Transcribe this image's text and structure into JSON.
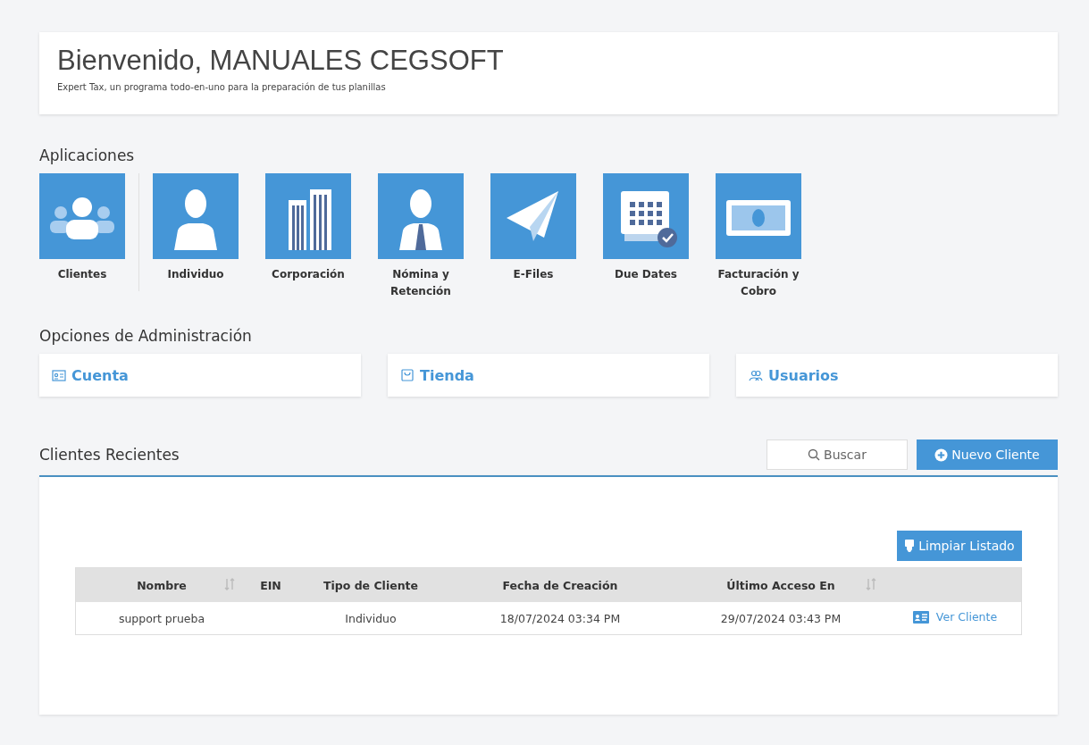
{
  "header": {
    "title": "Bienvenido, MANUALES CEGSOFT",
    "subtitle": "Expert Tax, un programa todo-en-uno para la preparación de tus planillas"
  },
  "applications": {
    "title": "Aplicaciones",
    "items": [
      {
        "kind": "clients",
        "label": "Clientes"
      },
      {
        "kind": "person",
        "label": "Individuo"
      },
      {
        "kind": "buildings",
        "label": "Corporación"
      },
      {
        "kind": "employee",
        "label": "Nómina y Retención"
      },
      {
        "kind": "plane",
        "label": "E-Files"
      },
      {
        "kind": "calendar",
        "label": "Due Dates"
      },
      {
        "kind": "money",
        "label": "Facturación y Cobro"
      }
    ]
  },
  "admin": {
    "title": "Opciones de Administración",
    "items": [
      {
        "kind": "account",
        "label": "Cuenta"
      },
      {
        "kind": "store",
        "label": "Tienda"
      },
      {
        "kind": "users",
        "label": "Usuarios"
      }
    ]
  },
  "recent": {
    "title": "Clientes Recientes",
    "search_button": "Buscar",
    "new_button": "Nuevo Cliente",
    "clear_button": "Limpiar Listado",
    "columns": [
      {
        "label": "Nombre",
        "sortable": true
      },
      {
        "label": "EIN",
        "sortable": false
      },
      {
        "label": "Tipo de Cliente",
        "sortable": false
      },
      {
        "label": "Fecha de Creación",
        "sortable": false
      },
      {
        "label": "Último Acceso En",
        "sortable": true
      },
      {
        "sortable": false
      }
    ],
    "rows": [
      {
        "name": "support prueba",
        "type": "Individuo",
        "created": "18/07/2024 03:34 PM",
        "last_access": "29/07/2024 03:43 PM",
        "action": "Ver Cliente"
      }
    ]
  }
}
